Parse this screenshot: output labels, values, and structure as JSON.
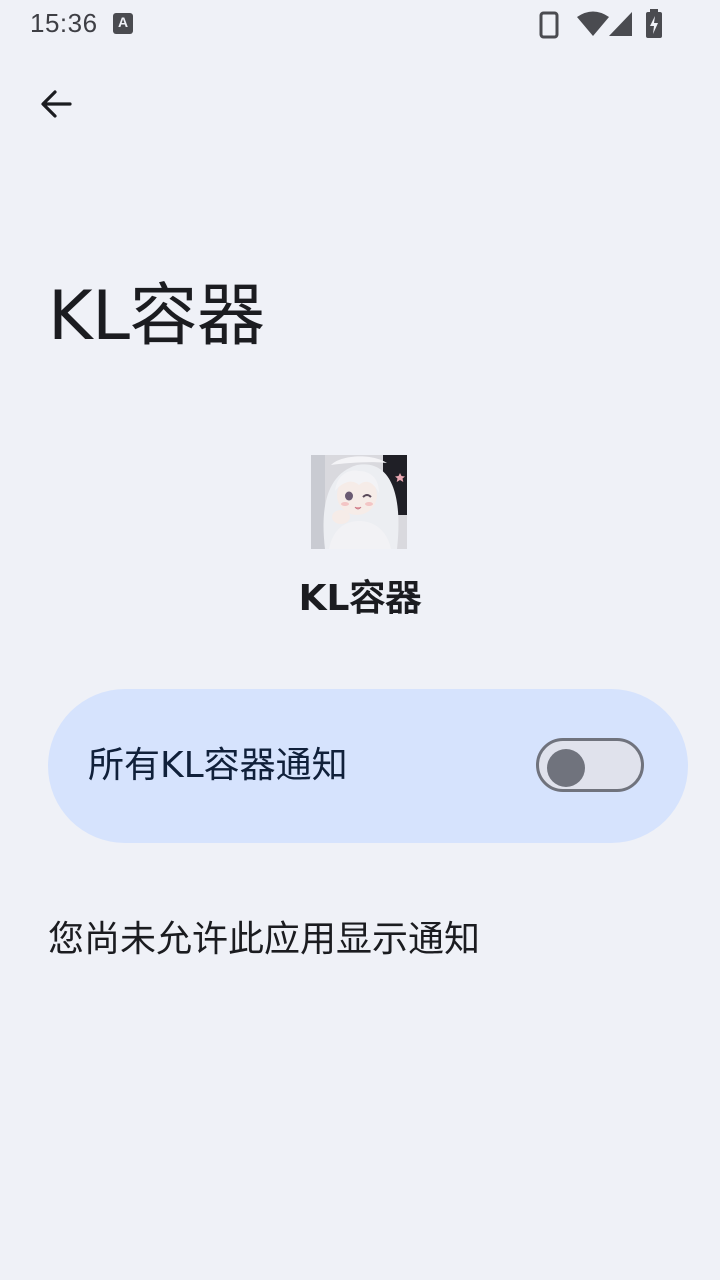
{
  "status_bar": {
    "time": "15:36",
    "keyboard_badge": "A"
  },
  "page": {
    "title": "KL容器"
  },
  "app": {
    "name": "KL容器",
    "icon": "app-avatar-icon"
  },
  "notifications_toggle": {
    "label": "所有KL容器通知",
    "enabled": false
  },
  "info": {
    "message": "您尚未允许此应用显示通知"
  },
  "colors": {
    "background": "#eff1f7",
    "card": "#d6e3fd",
    "switch_outline": "#70737d"
  }
}
